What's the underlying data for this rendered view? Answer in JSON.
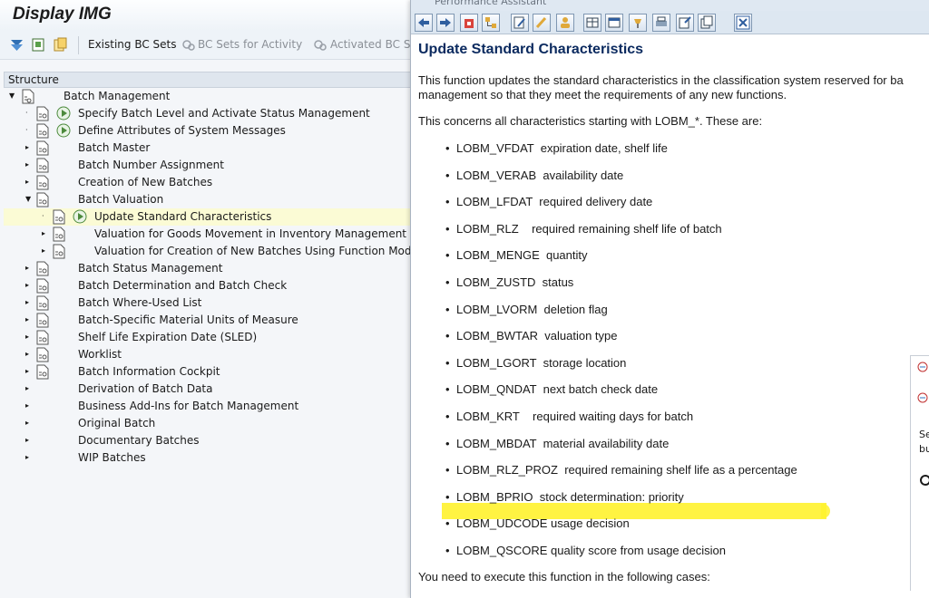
{
  "window": {
    "title": "Display IMG"
  },
  "toolbar": {
    "existing_bc_sets": "Existing BC Sets",
    "bc_sets_for_activity": "BC Sets for Activity",
    "activated_bc_sets": "Activated BC Se"
  },
  "structure": {
    "header": "Structure",
    "root": "Batch Management",
    "items": [
      {
        "label": "Specify Batch Level and Activate Status Management",
        "has_exec": true
      },
      {
        "label": "Define Attributes of System Messages",
        "has_exec": true
      },
      {
        "label": "Batch Master"
      },
      {
        "label": "Batch Number Assignment"
      },
      {
        "label": "Creation of New Batches"
      },
      {
        "label": "Batch Valuation",
        "expanded": true
      },
      {
        "label": "Update Standard Characteristics",
        "selected": true,
        "has_exec": true
      },
      {
        "label": "Valuation for Goods Movement in Inventory Management"
      },
      {
        "label": "Valuation for Creation of New Batches Using Function Module"
      },
      {
        "label": "Batch Status Management"
      },
      {
        "label": "Batch Determination and Batch Check"
      },
      {
        "label": "Batch Where-Used List"
      },
      {
        "label": "Batch-Specific Material Units of Measure"
      },
      {
        "label": "Shelf Life Expiration Date (SLED)"
      },
      {
        "label": "Worklist"
      },
      {
        "label": "Batch Information Cockpit"
      },
      {
        "label": "Derivation of Batch Data"
      },
      {
        "label": "Business Add-Ins for Batch Management"
      },
      {
        "label": "Original Batch"
      },
      {
        "label": "Documentary Batches"
      },
      {
        "label": "WIP Batches"
      }
    ]
  },
  "assistant": {
    "title": "Performance Assistant",
    "heading": "Update Standard Characteristics",
    "para1_line1": "This function updates the standard characteristics in the classification system reserved for ba",
    "para1_line2": "management so that they meet the requirements of any new functions.",
    "para2": "This concerns all characteristics starting with LOBM_*. These are:",
    "bullet_char": "•",
    "bullets": [
      "LOBM_VFDAT  expiration date, shelf life",
      "LOBM_VERAB  availability date",
      "LOBM_LFDAT  required delivery date",
      "LOBM_RLZ    required remaining shelf life of batch",
      "LOBM_MENGE  quantity",
      "LOBM_ZUSTD  status",
      "LOBM_LVORM  deletion flag",
      "LOBM_BWTAR  valuation type",
      "LOBM_LGORT  storage location",
      "LOBM_QNDAT  next batch check date",
      "LOBM_KRT    required waiting days for batch",
      "LOBM_MBDAT  material availability date",
      "LOBM_RLZ_PROZ  required remaining shelf life as a percentage",
      "LOBM_BPRIO  stock determination: priority",
      "LOBM_UDCODE usage decision",
      "LOBM_QSCORE quality score from usage decision"
    ],
    "para3": "You need to execute this function in the following cases:",
    "highlight_color": "#fff22e"
  },
  "side_panel": {
    "line1": "Se",
    "line2": "bu"
  }
}
